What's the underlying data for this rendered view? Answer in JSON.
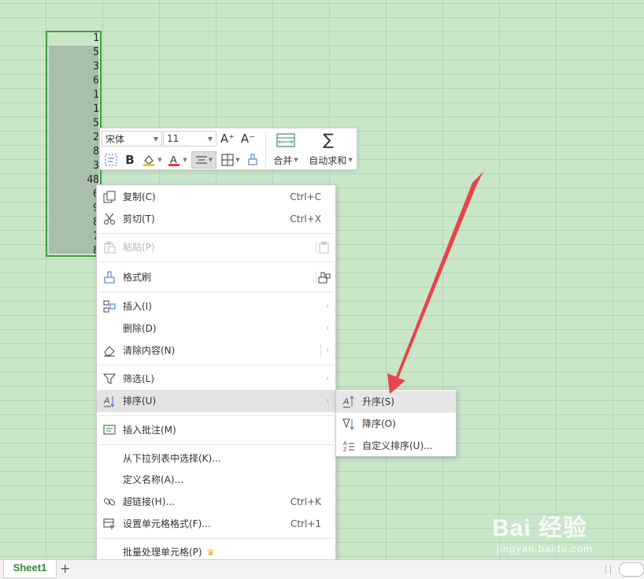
{
  "cells": [
    "1",
    "5",
    "3",
    "6",
    "1",
    "1",
    "5",
    "2",
    "8",
    "3",
    "48",
    "6",
    "9",
    "8",
    "7",
    "8"
  ],
  "toolbar": {
    "font_name": "宋体",
    "font_size": "11",
    "grow_font_icon": "A⁺",
    "shrink_font_icon": "A⁻",
    "merge_label": "合并",
    "autosum_label": "自动求和"
  },
  "menu": {
    "items": [
      {
        "label": "复制(C)",
        "shortcut": "Ctrl+C"
      },
      {
        "label": "剪切(T)",
        "shortcut": "Ctrl+X"
      },
      {
        "label": "粘贴(P)",
        "shortcut": ""
      },
      {
        "label": "格式刷",
        "shortcut": ""
      },
      {
        "label": "插入(I)",
        "shortcut": ""
      },
      {
        "label": "删除(D)",
        "shortcut": ""
      },
      {
        "label": "清除内容(N)",
        "shortcut": ""
      },
      {
        "label": "筛选(L)",
        "shortcut": ""
      },
      {
        "label": "排序(U)",
        "shortcut": ""
      },
      {
        "label": "插入批注(M)",
        "shortcut": ""
      },
      {
        "label": "从下拉列表中选择(K)...",
        "shortcut": ""
      },
      {
        "label": "定义名称(A)...",
        "shortcut": ""
      },
      {
        "label": "超链接(H)...",
        "shortcut": "Ctrl+K"
      },
      {
        "label": "设置单元格格式(F)...",
        "shortcut": "Ctrl+1"
      },
      {
        "label": "批量处理单元格(P)",
        "shortcut": ""
      }
    ],
    "arrow": "›"
  },
  "submenu": {
    "items": [
      {
        "label": "升序(S)"
      },
      {
        "label": "降序(O)"
      },
      {
        "label": "自定义排序(U)..."
      }
    ]
  },
  "sheets": {
    "active": "Sheet1",
    "add": "+"
  },
  "watermark": {
    "brand": "Bai 经验",
    "url": "jingyan.baidu.com"
  },
  "colors": {
    "sheet_bg": "#c9e6c9",
    "selection_border": "#3f9e3f",
    "annotation_arrow": "#e8434a",
    "sheet_tab_text": "#2e8b2e"
  }
}
